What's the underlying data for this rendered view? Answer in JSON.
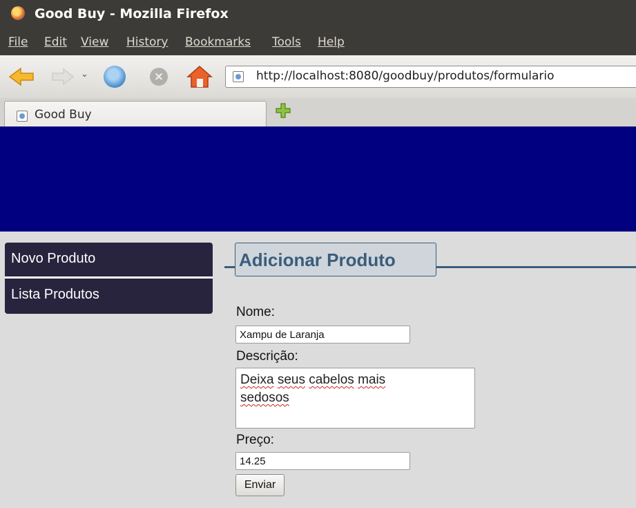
{
  "window": {
    "title": "Good Buy - Mozilla Firefox"
  },
  "menu": {
    "file": "File",
    "edit": "Edit",
    "view": "View",
    "history": "History",
    "bookmarks": "Bookmarks",
    "tools": "Tools",
    "help": "Help"
  },
  "toolbar": {
    "url": "http://localhost:8080/goodbuy/produtos/formulario",
    "icons": [
      "back-arrow-icon",
      "forward-arrow-icon",
      "chevron-down-icon",
      "reload-icon",
      "stop-icon",
      "home-icon"
    ]
  },
  "tabs": [
    {
      "label": "Good Buy",
      "active": true
    }
  ],
  "page": {
    "banner_color": "#000080",
    "sidebar": {
      "items": [
        {
          "label": "Novo Produto"
        },
        {
          "label": "Lista Produtos"
        }
      ]
    },
    "form": {
      "legend": "Adicionar Produto",
      "nome_label": "Nome:",
      "nome_value": "Xampu de Laranja",
      "descricao_label": "Descrição:",
      "descricao_words": [
        "Deixa",
        "seus",
        "cabelos",
        "mais",
        "sedosos"
      ],
      "preco_label": "Preço:",
      "preco_value": "14.25",
      "submit_label": "Enviar"
    }
  },
  "colors": {
    "titlebar": "#3c3b37",
    "banner": "#000080",
    "sidebar": "#28243e",
    "accent": "#3a5d7c",
    "page_bg": "#dcdcdc"
  }
}
